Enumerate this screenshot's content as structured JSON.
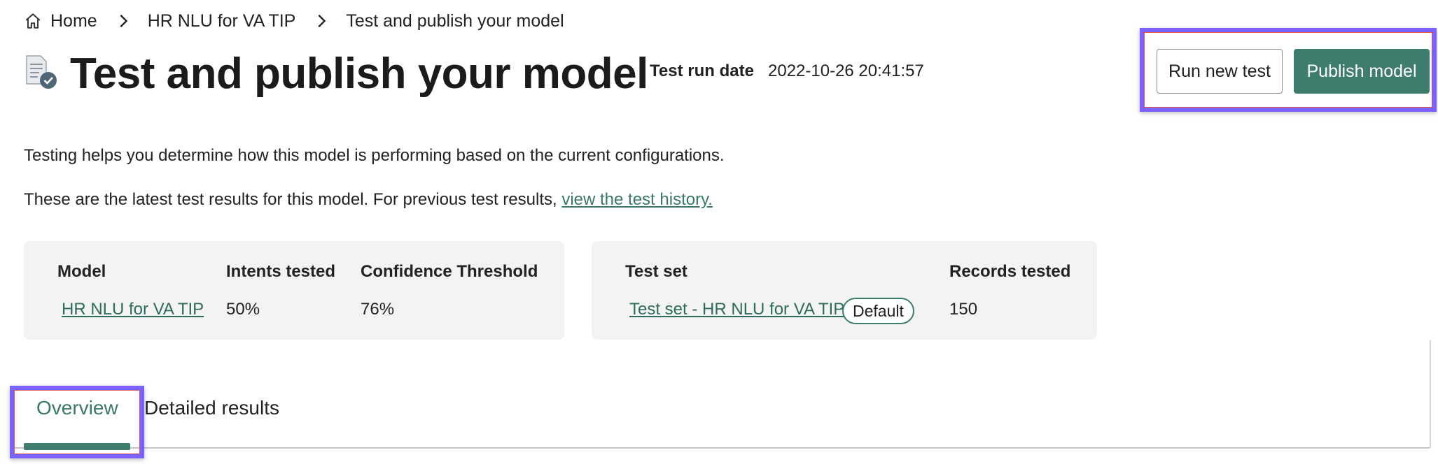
{
  "breadcrumb": {
    "items": [
      {
        "label": "Home"
      },
      {
        "label": "HR NLU for VA TIP"
      },
      {
        "label": "Test and publish your model"
      }
    ]
  },
  "header": {
    "title": "Test and publish your model",
    "run_date_label": "Test run date",
    "run_date_value": "2022-10-26 20:41:57"
  },
  "actions": {
    "run_new_test_label": "Run new test",
    "publish_model_label": "Publish model"
  },
  "description": {
    "line1": "Testing helps you determine how this model is performing based on the current configurations.",
    "line2_prefix": "These are the latest test results for this model. For previous test results,",
    "line2_link": "view the test history."
  },
  "model_card": {
    "headers": [
      "Model",
      "Intents tested",
      "Confidence Threshold"
    ],
    "values": [
      "HR NLU for VA TIP",
      "50%",
      "76%"
    ]
  },
  "testset_card": {
    "headers": [
      "Test set",
      "Records tested"
    ],
    "test_set_name": "Test set - HR NLU for VA TIP",
    "badge": "Default",
    "records_tested": "150"
  },
  "tabs": [
    {
      "label": "Overview",
      "selected": true
    },
    {
      "label": "Detailed results",
      "selected": false
    }
  ],
  "colors": {
    "accent": "#3e7d6d",
    "link": "#3a7866",
    "highlight": "#7b61ff",
    "card_bg": "#f3f3f3"
  },
  "icons": {
    "home": "home-icon",
    "separator": "chevron-right-icon",
    "page": "document-check-icon"
  }
}
